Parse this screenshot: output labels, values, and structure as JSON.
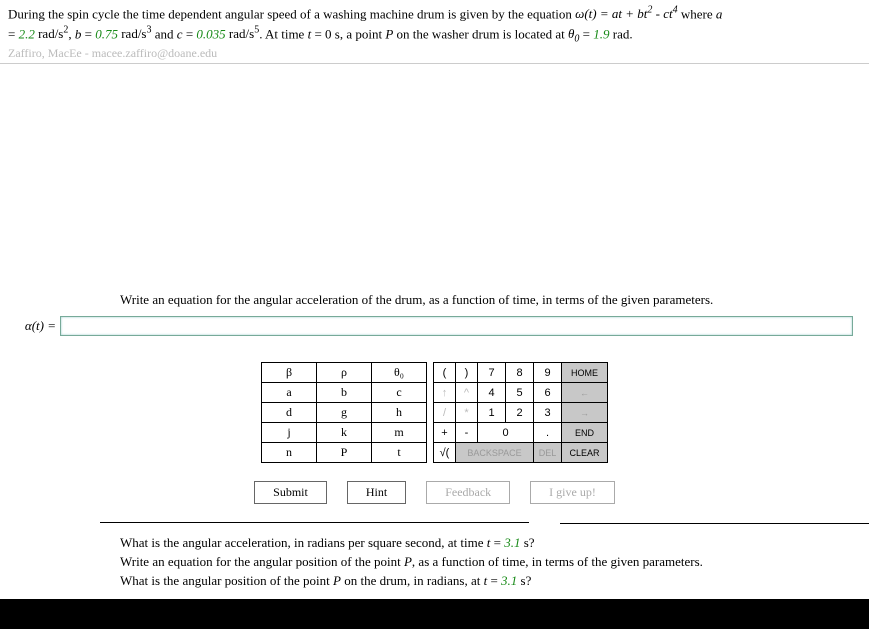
{
  "problem": {
    "intro_a": "During the spin cycle the time dependent angular speed of a washing machine drum is given by the equation ",
    "omega_eq": "ω(t) = at + bt",
    "omega_eq2": " - ct",
    "where": " where ",
    "a_eq": "a",
    "eq_sign": " = ",
    "a_val": "2.2",
    "a_unit": " rad/s",
    "b_eq": "b",
    "b_val": "0.75",
    "b_unit": " rad/s",
    "c_eq": "c",
    "c_val": "0.035",
    "c_unit": " rad/s",
    "time_txt": ". At time ",
    "t_var": "t",
    "t_val": "= 0 s, a point ",
    "p_var": "P",
    "p_txt": " on the washer drum is located at ",
    "theta0": "θ",
    "theta0_sub": "0",
    "theta_val": "1.9",
    "theta_unit": " rad.",
    "and": " and ",
    "comma": ", "
  },
  "watermark": "Zaffiro, MacEe - macee.zaffiro@doane.edu",
  "question1": "Write an equation for the angular acceleration of the drum, as a function of time, in terms of the given parameters.",
  "answer_label": "α(t) = ",
  "palette": {
    "r1": [
      "β",
      "ρ",
      "θ₀"
    ],
    "r2": [
      "a",
      "b",
      "c"
    ],
    "r3": [
      "d",
      "g",
      "h"
    ],
    "r4": [
      "j",
      "k",
      "m"
    ],
    "r5": [
      "n",
      "P",
      "t"
    ]
  },
  "numpad": {
    "r1": [
      "(",
      ")",
      "7",
      "8",
      "9",
      "HOME"
    ],
    "r2": [
      "↑",
      "^",
      "4",
      "5",
      "6",
      "←"
    ],
    "r3": [
      "/",
      "*",
      "1",
      "2",
      "3",
      "→"
    ],
    "r4": [
      "+",
      "-",
      "0",
      ".",
      "END"
    ],
    "r5": [
      "√(",
      "BACKSPACE",
      "DEL",
      "CLEAR"
    ]
  },
  "buttons": {
    "submit": "Submit",
    "hint": "Hint",
    "feedback": "Feedback",
    "giveup": "I give up!"
  },
  "subq": {
    "q2a": "What is the angular acceleration, in radians per square second, at time ",
    "q2_tval": "3.1",
    "q2b": " s?",
    "q3": "Write an equation for the angular position of the point ",
    "q3b": ", as a function of time, in terms of the given parameters.",
    "q4a": "What is the angular position of the point ",
    "q4b": " on the drum, in radians, at ",
    "q4_tval": "3.1",
    "q4c": " s?"
  }
}
